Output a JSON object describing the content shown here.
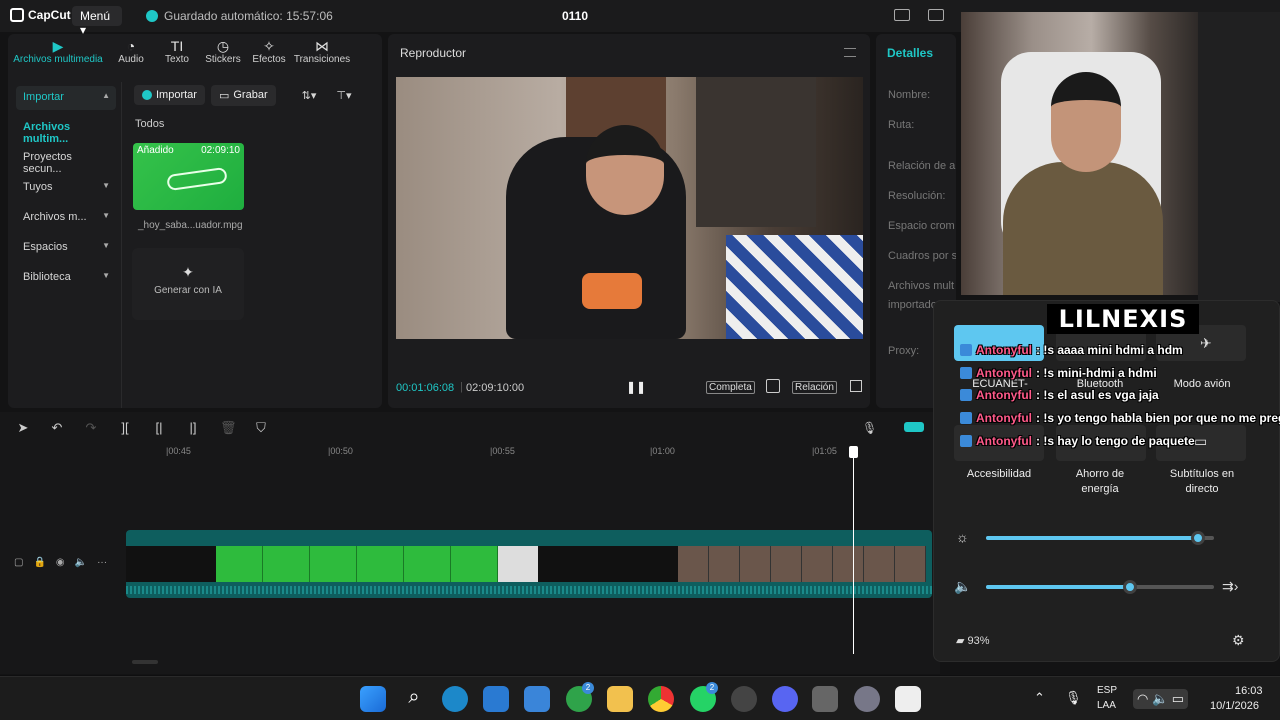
{
  "app": {
    "logo": "CapCut",
    "menu": "Menú",
    "autosave": "Guardado automático: 15:57:06",
    "project": "0110"
  },
  "tools": [
    "Archivos multimedia",
    "Audio",
    "Texto",
    "Stickers",
    "Efectos",
    "Transiciones"
  ],
  "sidebar": {
    "items": [
      "Importar",
      "Archivos multim...",
      "Proyectos secun...",
      "Tuyos",
      "Archivos m...",
      "Espacios",
      "Biblioteca"
    ]
  },
  "library": {
    "import_btn": "Importar",
    "record_btn": "Grabar",
    "all_label": "Todos",
    "thumb_added": "Añadido",
    "thumb_duration": "02:09:10",
    "thumb_name": "_hoy_saba...uador.mpg",
    "gen_ai": "Generar con IA"
  },
  "player": {
    "title": "Reproductor",
    "time_current": "00:01:06:08",
    "time_total": "02:09:10:00",
    "btn_full": "Completa",
    "btn_ratio": "Relación"
  },
  "details": {
    "title": "Detalles",
    "rows": [
      "Nombre:",
      "Ruta:",
      "Relación de a",
      "Resolución:",
      "Espacio crom",
      "Cuadros por s",
      "Archivos mult",
      "importado:",
      "Proxy:"
    ]
  },
  "timeline": {
    "ticks": [
      "|00:45",
      "|00:50",
      "|00:55",
      "|01:00",
      "|01:05"
    ]
  },
  "overlay": {
    "name": "LILNEXIS"
  },
  "chat": [
    {
      "user": "Antonyful",
      "msg": ": !s aaaa mini hdmi a hdm"
    },
    {
      "user": "Antonyful",
      "msg": ": !s mini-hdmi a hdmi"
    },
    {
      "user": "Antonyful",
      "msg": ": !s el asul es vga jaja"
    },
    {
      "user": "Antonyful",
      "msg": ": !s yo tengo habla bien por que no me pregu"
    },
    {
      "user": "Antonyful",
      "msg": ": !s hay lo tengo de paquete"
    }
  ],
  "quick": {
    "wifi_label": "ECUANET-",
    "bluetooth": "Bluetooth",
    "airplane": "Modo avión",
    "accessibility": "Accesibilidad",
    "energy_line1": "Ahorro de",
    "energy_line2": "energía",
    "captions_line1": "Subtítulos en",
    "captions_line2": "directo",
    "brightness_level": 0.93,
    "volume_level": 0.63,
    "battery": "93%"
  },
  "taskbar": {
    "lang1": "ESP",
    "lang2": "LAA",
    "time": "16:03",
    "date": "10/1/2026",
    "badge_xbox": "2",
    "badge_whatsapp": "2"
  },
  "colors": {
    "accent": "#1fc7c6",
    "quick_accent": "#5ec7f0",
    "chat_user": "#ff5a8a"
  }
}
